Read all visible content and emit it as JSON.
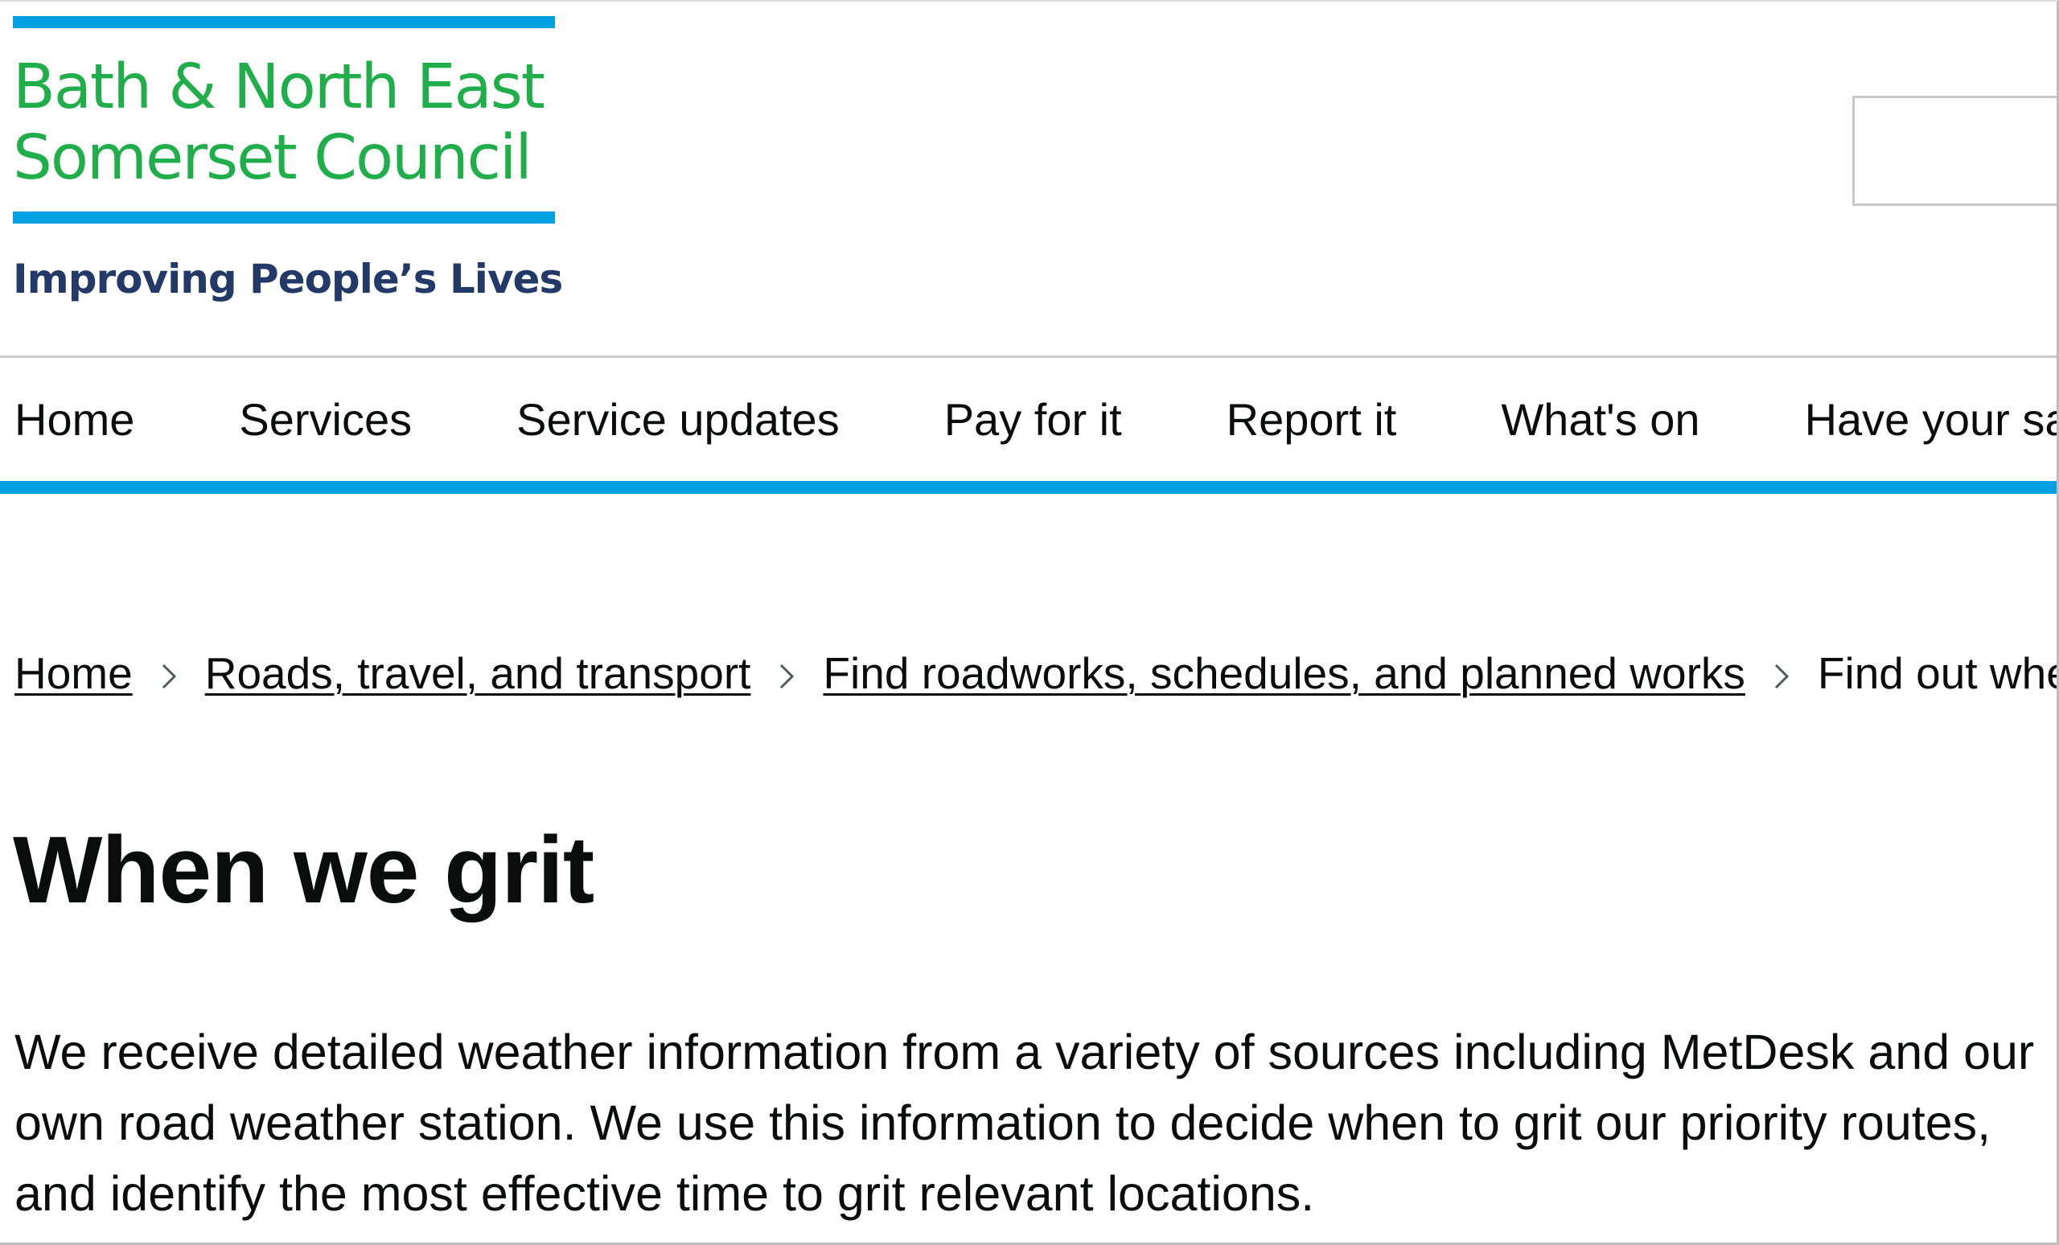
{
  "header": {
    "logo": {
      "line1": "Bath & North East",
      "line2": "Somerset Council",
      "tagline": "Improving People’s Lives",
      "colors": {
        "rule": "#00a0e1",
        "name": "#1fae4a",
        "tagline": "#233a68"
      }
    },
    "search": {
      "value": "",
      "placeholder": ""
    }
  },
  "nav": {
    "items": [
      {
        "label": "Home"
      },
      {
        "label": "Services"
      },
      {
        "label": "Service updates"
      },
      {
        "label": "Pay for it"
      },
      {
        "label": "Report it"
      },
      {
        "label": "What's on"
      },
      {
        "label": "Have your say"
      }
    ],
    "accent_color": "#00a0e1"
  },
  "breadcrumb": {
    "items": [
      {
        "label": "Home"
      },
      {
        "label": "Roads, travel, and transport"
      },
      {
        "label": "Find roadworks, schedules, and planned works"
      },
      {
        "label": "Find out when we grit"
      }
    ],
    "separator_icon": "chevron-right-icon"
  },
  "main": {
    "title": "When we grit",
    "paragraph": "We receive detailed weather information from a variety of sources including MetDesk and our own road weather station. We use this information to decide when to grit our priority routes, and identify the most effective time to grit relevant locations."
  }
}
